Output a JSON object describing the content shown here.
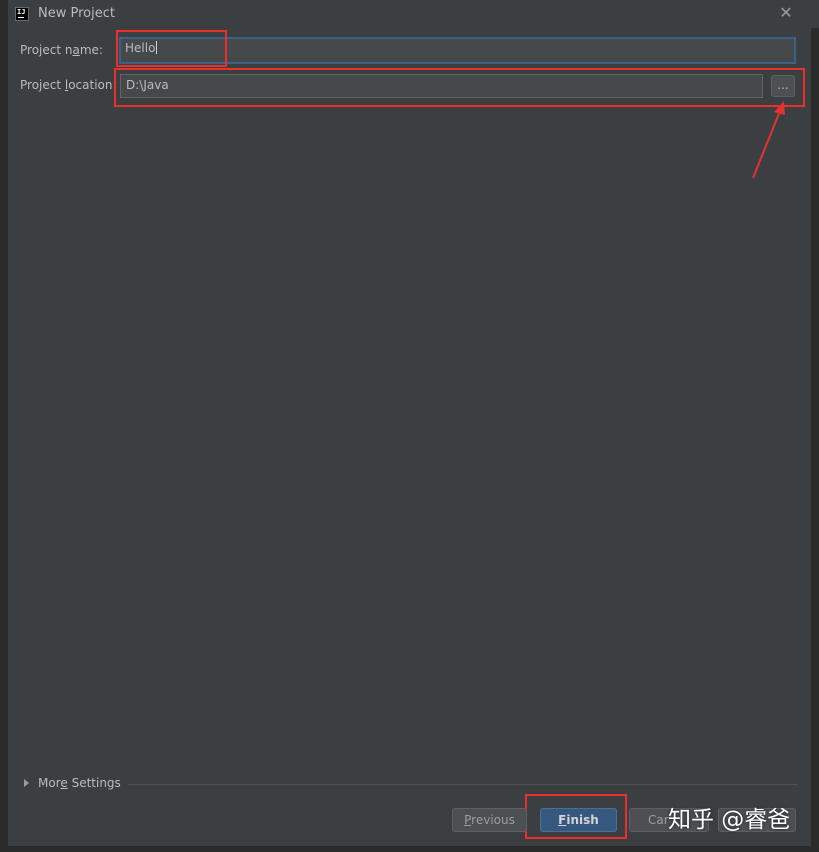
{
  "window": {
    "title": "New Project",
    "icon": "intellij-idea-icon",
    "icon_text": "IJ"
  },
  "form": {
    "name_label_pre": "Project n",
    "name_label_mn": "a",
    "name_label_post": "me:",
    "name_value": "Hello",
    "location_label_pre": "Project ",
    "location_label_mn": "l",
    "location_label_post": "ocation:",
    "location_value": "D:\\Java",
    "browse_label": "..."
  },
  "more_settings": {
    "label_pre": "Mor",
    "label_mn": "e",
    "label_post": " Settings"
  },
  "buttons": {
    "previous_pre": "",
    "previous_mn": "P",
    "previous_post": "revious",
    "finish_pre": "",
    "finish_mn": "F",
    "finish_post": "inish",
    "cancel_visible": "Car"
  },
  "watermark": "知乎 @睿爸",
  "colors": {
    "background": "#3c3f41",
    "accent": "#365880",
    "annotation": "#e8312f"
  }
}
